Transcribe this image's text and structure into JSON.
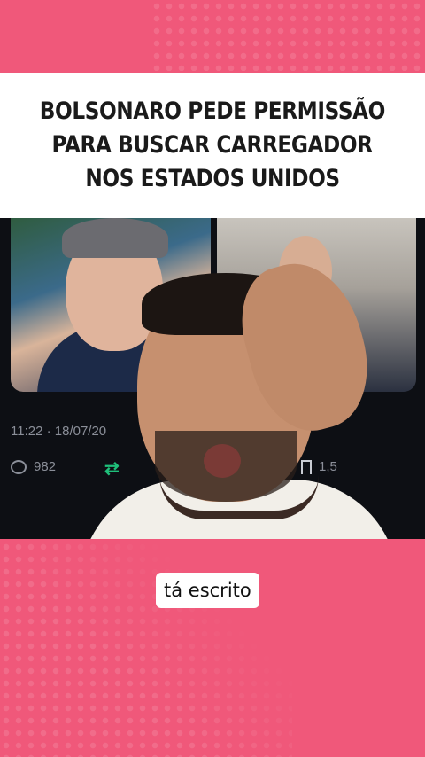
{
  "headline": {
    "lines": [
      "BOLSONARO PEDE PERMISSÃO",
      "PARA BUSCAR CARREGADOR",
      "NOS ESTADOS UNIDOS"
    ]
  },
  "tweet": {
    "timestamp": "11:22 · 18/07/20",
    "replies": "982",
    "bookmarks": "1,5"
  },
  "caption": {
    "text": "tá escrito"
  },
  "colors": {
    "background": "#f0587a",
    "headline_bg": "#ffffff",
    "retweet": "#1fbf7a"
  }
}
